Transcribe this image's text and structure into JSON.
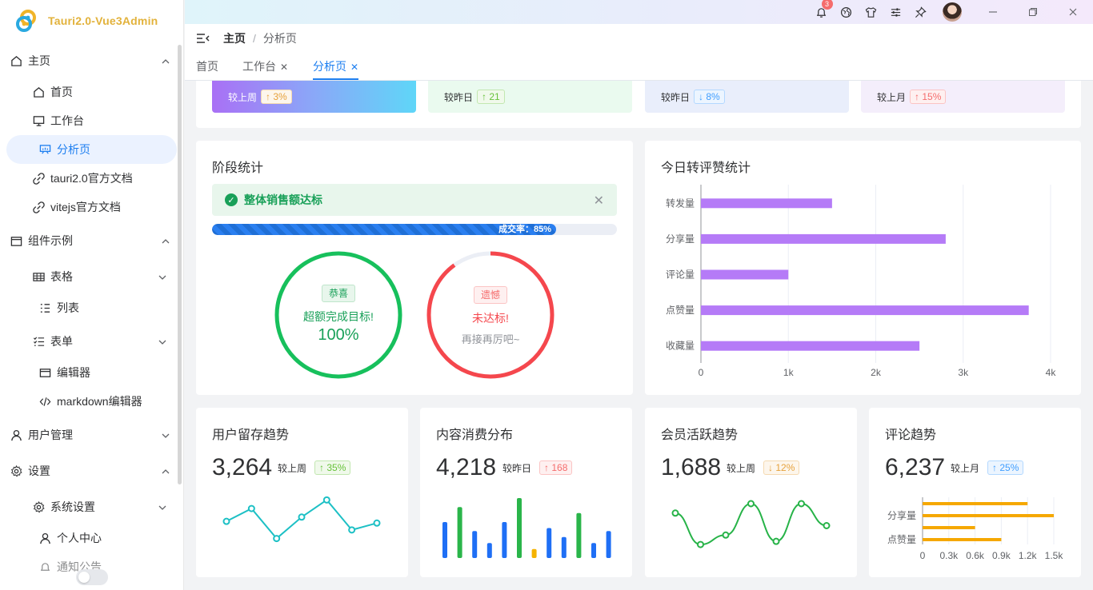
{
  "app": {
    "title": "Tauri2.0-Vue3Admin"
  },
  "sidebar": {
    "items": [
      {
        "label": "主页"
      },
      {
        "label": "首页"
      },
      {
        "label": "工作台"
      },
      {
        "label": "分析页"
      },
      {
        "label": "tauri2.0官方文档"
      },
      {
        "label": "vitejs官方文档"
      },
      {
        "label": "组件示例"
      },
      {
        "label": "表格"
      },
      {
        "label": "列表"
      },
      {
        "label": "表单"
      },
      {
        "label": "编辑器"
      },
      {
        "label": "markdown编辑器"
      },
      {
        "label": "用户管理"
      },
      {
        "label": "设置"
      },
      {
        "label": "系统设置"
      },
      {
        "label": "个人中心"
      },
      {
        "label": "通知公告"
      }
    ]
  },
  "header": {
    "notification_count": "3"
  },
  "breadcrumb": {
    "root": "主页",
    "sep": "/",
    "current": "分析页"
  },
  "tabs": [
    {
      "label": "首页"
    },
    {
      "label": "工作台"
    },
    {
      "label": "分析页"
    }
  ],
  "top_stats": [
    {
      "label": "较上周",
      "delta": "↑ 3%"
    },
    {
      "label": "较昨日",
      "delta": "↑ 21"
    },
    {
      "label": "较昨日",
      "delta": "↓ 8%"
    },
    {
      "label": "较上月",
      "delta": "↑ 15%"
    }
  ],
  "stage": {
    "title": "阶段统计",
    "alert": "整体销售额达标",
    "progress_label": "成交率：85%",
    "progress_value": 0.85,
    "success": {
      "tag": "恭喜",
      "text": "超额完成目标!",
      "value": "100%",
      "ratio": 1.0
    },
    "fail": {
      "tag": "遗憾",
      "text": "未达标!",
      "sub": "再接再厉吧~",
      "ratio": 0.9
    }
  },
  "today": {
    "title": "今日转评赞统计"
  },
  "cards": {
    "retention": {
      "title": "用户留存趋势",
      "value": "3,264",
      "cmp": "较上周",
      "delta": "↑ 35%"
    },
    "consumption": {
      "title": "内容消费分布",
      "value": "4,218",
      "cmp": "较昨日",
      "delta": "↑ 168"
    },
    "members": {
      "title": "会员活跃趋势",
      "value": "1,688",
      "cmp": "较上周",
      "delta": "↓ 12%"
    },
    "comments": {
      "title": "评论趋势",
      "value": "6,237",
      "cmp": "较上月",
      "delta": "↑ 25%"
    }
  },
  "chart_data": [
    {
      "type": "bar",
      "orientation": "horizontal",
      "categories": [
        "转发量",
        "分享量",
        "评论量",
        "点赞量",
        "收藏量"
      ],
      "values": [
        1500,
        2800,
        1000,
        3750,
        2500
      ],
      "xlim": [
        0,
        4000
      ],
      "xticks": [
        "0",
        "1k",
        "2k",
        "3k",
        "4k"
      ],
      "color": "#b57bf7",
      "grid": true
    },
    {
      "type": "line",
      "values": [
        40,
        55,
        20,
        45,
        65,
        30,
        38
      ],
      "color": "#1dc0c5"
    },
    {
      "type": "bar",
      "values": [
        60,
        85,
        45,
        25,
        60,
        100,
        15,
        50,
        35,
        75,
        25,
        45
      ],
      "colors": [
        "#1f6ff5",
        "#2ab54a",
        "#1f6ff5",
        "#1f6ff5",
        "#1f6ff5",
        "#2ab54a",
        "#f5b300",
        "#1f6ff5",
        "#1f6ff5",
        "#2ab54a",
        "#1f6ff5",
        "#1f6ff5"
      ]
    },
    {
      "type": "line",
      "smooth": true,
      "values": [
        55,
        5,
        20,
        70,
        10,
        70,
        35
      ],
      "color": "#27b348"
    },
    {
      "type": "bar",
      "orientation": "horizontal",
      "categories": [
        "分享量",
        "点赞量"
      ],
      "values": [
        1200,
        1500,
        600,
        900
      ],
      "xticks": [
        "0",
        "0.3k",
        "0.6k",
        "0.9k",
        "1.2k",
        "1.5k"
      ],
      "xlim": [
        0,
        1500
      ],
      "color": "#f5a800"
    }
  ]
}
